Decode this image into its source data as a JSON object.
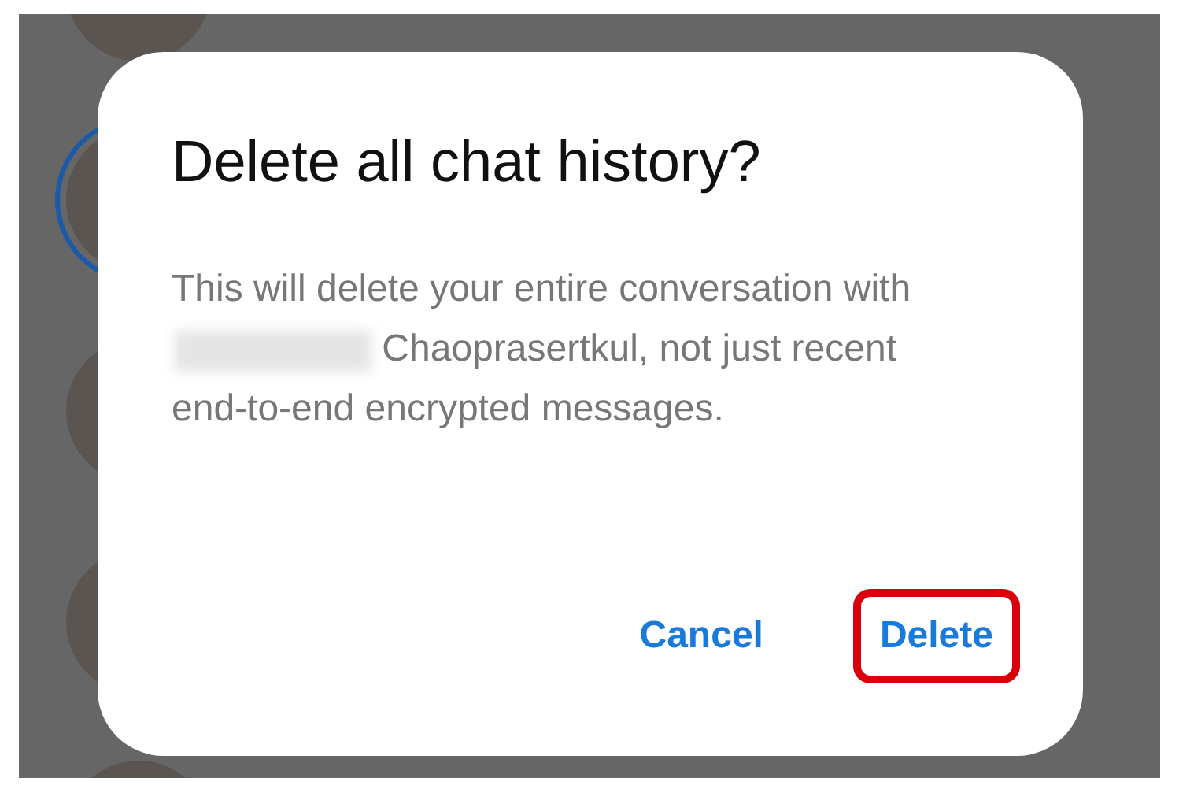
{
  "dialog": {
    "title": "Delete all chat history?",
    "message_before": "This will delete your entire conversation with",
    "message_after": "Chaoprasertkul, not just recent end-to-end encrypted messages.",
    "name_blurred": true
  },
  "buttons": [
    {
      "label": "Cancel",
      "highlighted": false
    },
    {
      "label": "Delete",
      "highlighted": true
    }
  ]
}
